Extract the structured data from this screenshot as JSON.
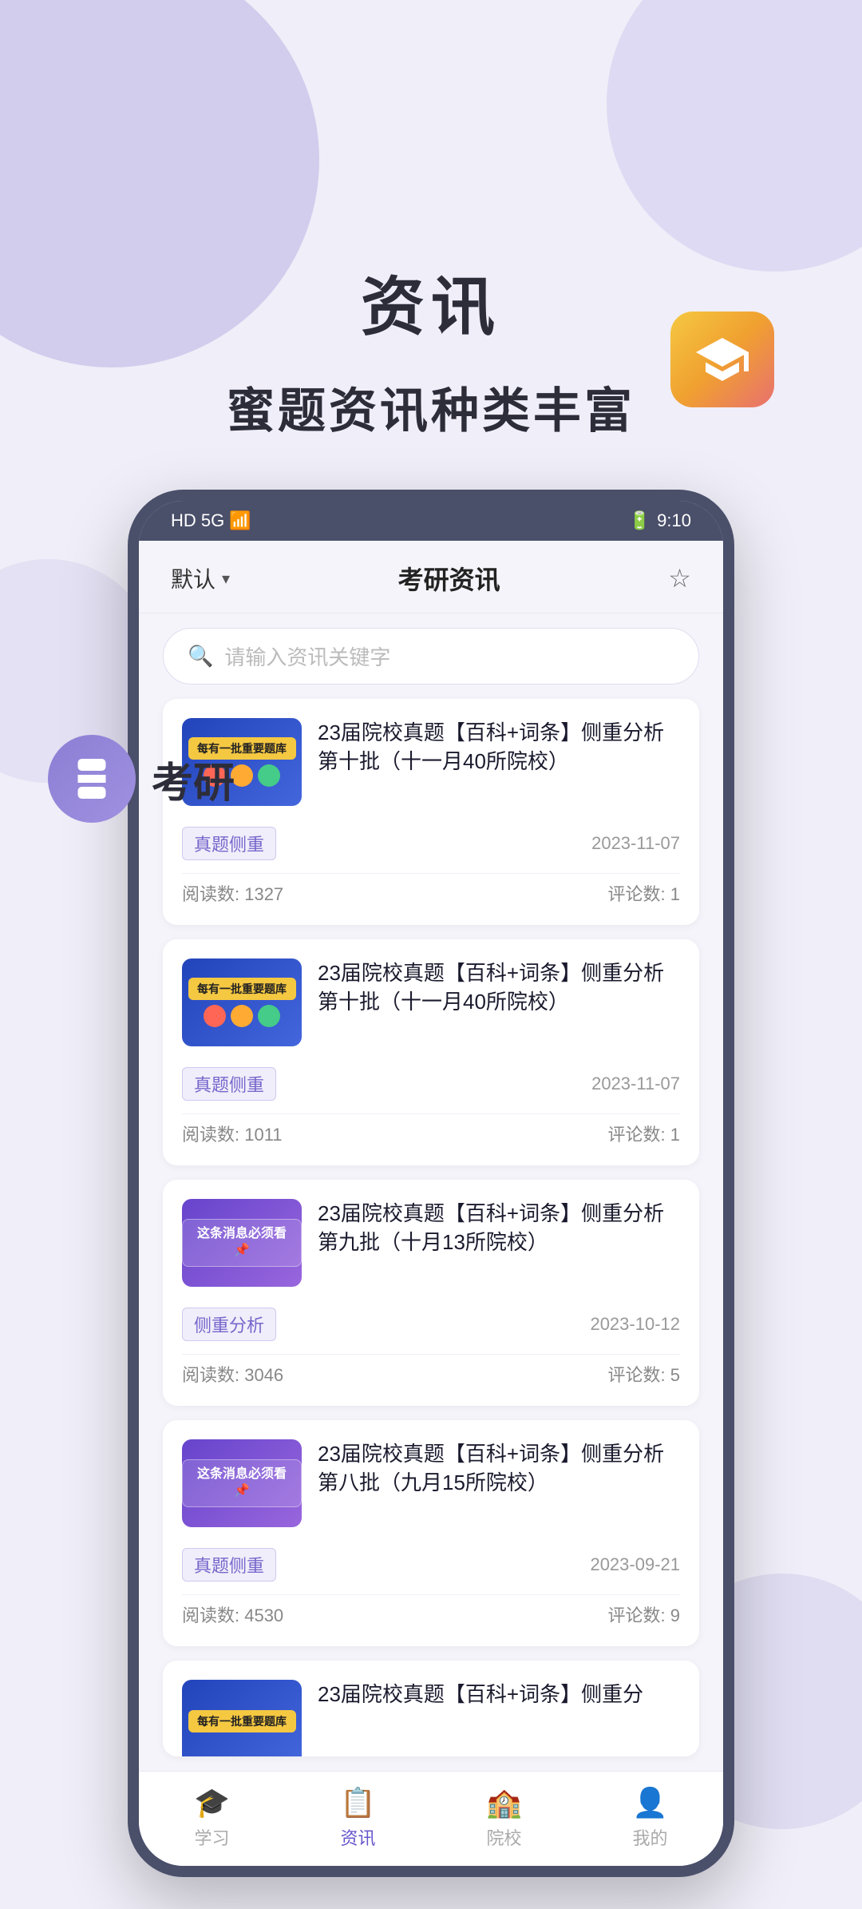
{
  "page": {
    "bg_title": "资讯",
    "bg_subtitle": "蜜题资讯种类丰富",
    "kaoyan_label": "考研"
  },
  "phone": {
    "status_left": "HD 5G",
    "status_time": "9:10",
    "header": {
      "default_label": "默认",
      "title": "考研资讯",
      "star_label": "☆"
    },
    "search": {
      "placeholder": "请输入资讯关键字"
    },
    "news_items": [
      {
        "id": 1,
        "title": "23届院校真题【百科+词条】侧重分析第十批（十一月40所院校）",
        "tag": "真题侧重",
        "date": "2023-11-07",
        "reads": "阅读数: 1327",
        "comments": "评论数: 1",
        "thumb_type": "colorful"
      },
      {
        "id": 2,
        "title": "23届院校真题【百科+词条】侧重分析第十批（十一月40所院校）",
        "tag": "真题侧重",
        "date": "2023-11-07",
        "reads": "阅读数: 1011",
        "comments": "评论数: 1",
        "thumb_type": "colorful"
      },
      {
        "id": 3,
        "title": "23届院校真题【百科+词条】侧重分析第九批（十月13所院校）",
        "tag": "侧重分析",
        "date": "2023-10-12",
        "reads": "阅读数: 3046",
        "comments": "评论数: 5",
        "thumb_type": "purple",
        "thumb_text": "这条消息必须看"
      },
      {
        "id": 4,
        "title": "23届院校真题【百科+词条】侧重分析第八批（九月15所院校）",
        "tag": "真题侧重",
        "date": "2023-09-21",
        "reads": "阅读数: 4530",
        "comments": "评论数: 9",
        "thumb_type": "purple",
        "thumb_text": "这条消息必须看"
      },
      {
        "id": 5,
        "title": "23届院校真题【百科+词条】侧重分",
        "tag": "",
        "date": "",
        "reads": "",
        "comments": "",
        "thumb_type": "colorful",
        "partial": true
      }
    ],
    "bottom_nav": [
      {
        "label": "学习",
        "icon": "graduation",
        "active": false
      },
      {
        "label": "资讯",
        "icon": "news",
        "active": true
      },
      {
        "label": "院校",
        "icon": "school",
        "active": false
      },
      {
        "label": "我的",
        "icon": "profile",
        "active": false
      }
    ]
  }
}
